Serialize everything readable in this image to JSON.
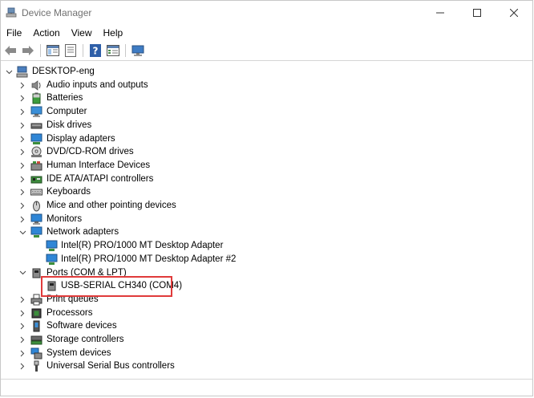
{
  "window": {
    "title": "Device Manager"
  },
  "menu": {
    "file": "File",
    "action": "Action",
    "view": "View",
    "help": "Help"
  },
  "toolbar": {
    "icons": [
      "back-arrow-icon",
      "forward-arrow-icon",
      "show-hide-tree-icon",
      "properties-icon",
      "help-icon",
      "view-resources-icon",
      "monitor-scan-icon"
    ]
  },
  "tree": {
    "root": "DESKTOP-eng",
    "categories": [
      {
        "label": "Audio inputs and outputs",
        "icon": "speaker-icon",
        "expanded": false
      },
      {
        "label": "Batteries",
        "icon": "battery-icon",
        "expanded": false
      },
      {
        "label": "Computer",
        "icon": "computer-icon",
        "expanded": false
      },
      {
        "label": "Disk drives",
        "icon": "disk-drive-icon",
        "expanded": false
      },
      {
        "label": "Display adapters",
        "icon": "display-adapter-icon",
        "expanded": false
      },
      {
        "label": "DVD/CD-ROM drives",
        "icon": "dvd-icon",
        "expanded": false
      },
      {
        "label": "Human Interface Devices",
        "icon": "hid-icon",
        "expanded": false
      },
      {
        "label": "IDE ATA/ATAPI controllers",
        "icon": "ide-controller-icon",
        "expanded": false
      },
      {
        "label": "Keyboards",
        "icon": "keyboard-icon",
        "expanded": false
      },
      {
        "label": "Mice and other pointing devices",
        "icon": "mouse-icon",
        "expanded": false
      },
      {
        "label": "Monitors",
        "icon": "monitor-icon",
        "expanded": false
      },
      {
        "label": "Network adapters",
        "icon": "network-adapter-icon",
        "expanded": true,
        "children": [
          "Intel(R) PRO/1000 MT Desktop Adapter",
          "Intel(R) PRO/1000 MT Desktop Adapter #2"
        ]
      },
      {
        "label": "Ports (COM & LPT)",
        "icon": "port-icon",
        "expanded": true,
        "children": [
          "USB-SERIAL CH340 (COM4)"
        ]
      },
      {
        "label": "Print queues",
        "icon": "printer-icon",
        "expanded": false
      },
      {
        "label": "Processors",
        "icon": "processor-icon",
        "expanded": false
      },
      {
        "label": "Software devices",
        "icon": "software-device-icon",
        "expanded": false
      },
      {
        "label": "Storage controllers",
        "icon": "storage-controller-icon",
        "expanded": false
      },
      {
        "label": "System devices",
        "icon": "system-devices-icon",
        "expanded": false
      },
      {
        "label": "Universal Serial Bus controllers",
        "icon": "usb-icon",
        "expanded": false
      }
    ]
  },
  "highlight": {
    "color": "#e03b3b"
  }
}
